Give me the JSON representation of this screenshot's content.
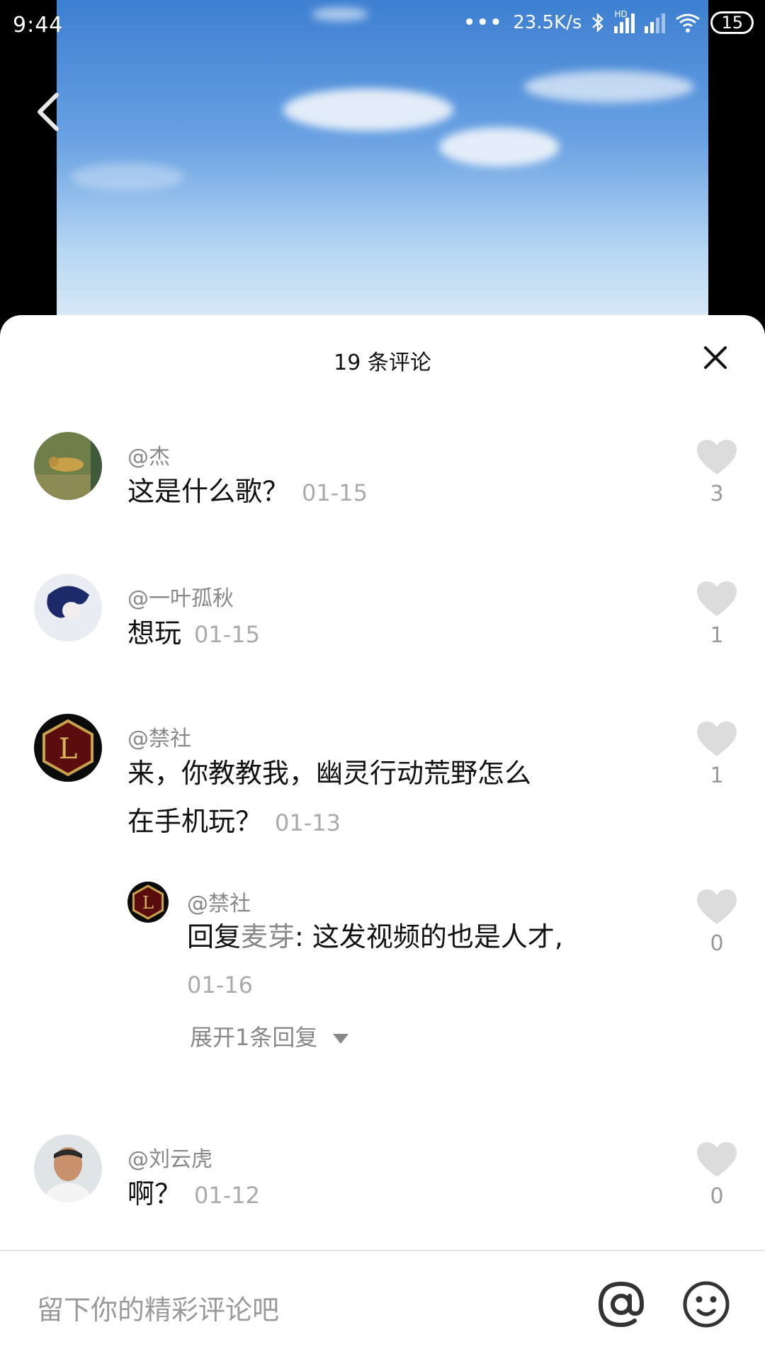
{
  "status_bar": {
    "time": "9:44",
    "net_speed": "23.5K/s",
    "network_type": "HD",
    "battery": "15"
  },
  "comments_panel": {
    "title": "19 条评论",
    "comments": [
      {
        "author": "@杰",
        "text": "这是什么歌？",
        "date": "01-15",
        "likes": "3"
      },
      {
        "author": "@一叶孤秋",
        "text": "想玩",
        "date": "01-15",
        "likes": "1"
      },
      {
        "author": "@禁社",
        "text_line1": "来，你教教我，幽灵行动荒野怎么",
        "text_line2": "在手机玩？",
        "date": "01-13",
        "likes": "1",
        "reply": {
          "author": "@禁社",
          "prefix": "回复",
          "reply_to": "麦芽",
          "text": ": 这发视频的也是人才,",
          "date": "01-16",
          "likes": "0"
        },
        "expand_label": "展开1条回复"
      },
      {
        "author": "@刘云虎",
        "text": "啊？",
        "date": "01-12",
        "likes": "0"
      }
    ]
  },
  "input": {
    "placeholder": "留下你的精彩评论吧"
  },
  "icons": {
    "back": "chevron-left-icon",
    "close": "close-icon",
    "like": "heart-icon",
    "mention": "at-icon",
    "emoji": "emoji-icon",
    "expand": "triangle-down-icon"
  }
}
